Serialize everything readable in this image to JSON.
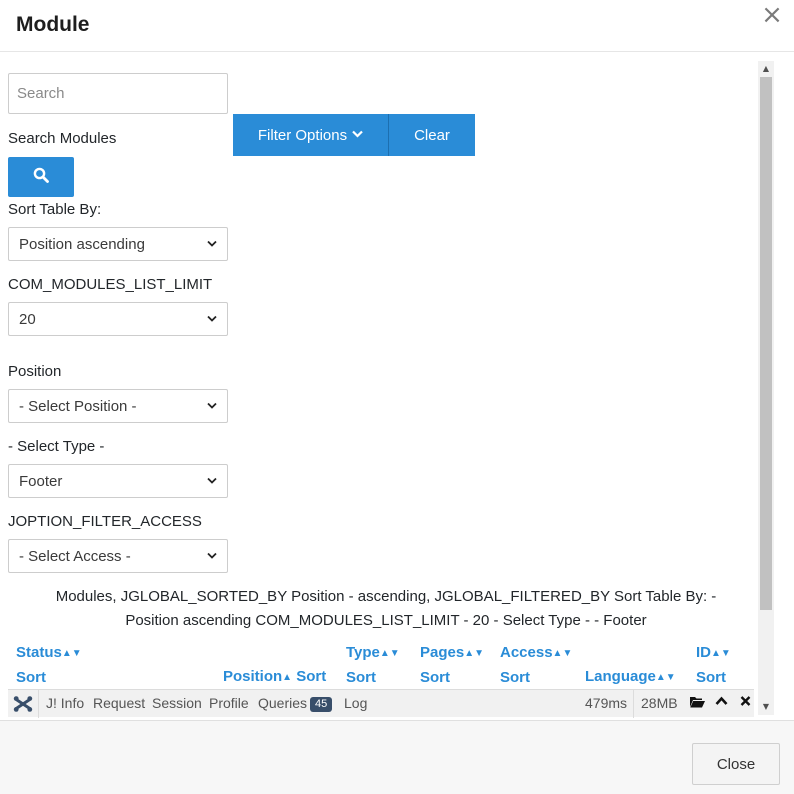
{
  "modal": {
    "title": "Module",
    "close_x": "×",
    "close_label": "Close"
  },
  "search": {
    "placeholder": "Search",
    "label": "Search Modules",
    "filter_options_label": "Filter Options",
    "clear_label": "Clear"
  },
  "sort": {
    "label": "Sort Table By:",
    "value": "Position ascending"
  },
  "limit": {
    "label": "COM_MODULES_LIST_LIMIT",
    "value": "20"
  },
  "position": {
    "label": "Position",
    "value": "- Select Position -"
  },
  "type": {
    "label": "- Select Type -",
    "value": "Footer"
  },
  "access": {
    "label": "JOPTION_FILTER_ACCESS",
    "value": "- Select Access -"
  },
  "summary": "Modules, JGLOBAL_SORTED_BY Position - ascending, JGLOBAL_FILTERED_BY Sort Table By: - Position ascending COM_MODULES_LIST_LIMIT - 20 - Select Type - - Footer",
  "table": {
    "headers": [
      {
        "label": "Status",
        "sort": "Sort"
      },
      {
        "label": "Position",
        "sort": "Sort"
      },
      {
        "label": "Type",
        "sort": "Sort"
      },
      {
        "label": "Pages",
        "sort": "Sort"
      },
      {
        "label": "Access",
        "sort": "Sort"
      },
      {
        "label": "Language",
        "sort": ""
      },
      {
        "label": "ID",
        "sort": "Sort"
      }
    ]
  },
  "debug_bar": {
    "items": [
      "J! Info",
      "Request",
      "Session",
      "Profile",
      "Queries",
      "Log"
    ],
    "queries_count": "45",
    "time": "479ms",
    "memory": "28MB"
  },
  "colors": {
    "primary": "#2a8cd7",
    "badge": "#384e6a"
  }
}
